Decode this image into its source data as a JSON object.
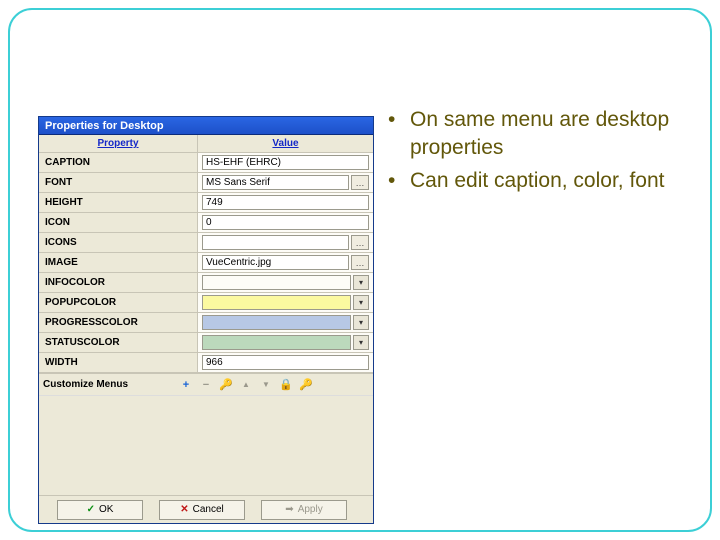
{
  "dialog": {
    "title": "Properties for Desktop",
    "header_property": "Property",
    "header_value": "Value",
    "rows": {
      "caption": {
        "label": "CAPTION",
        "value": "HS-EHF (EHRC)"
      },
      "font": {
        "label": "FONT",
        "value": "MS Sans Serif"
      },
      "height": {
        "label": "HEIGHT",
        "value": "749"
      },
      "icon": {
        "label": "ICON",
        "value": "0"
      },
      "icons": {
        "label": "ICONS",
        "value": ""
      },
      "image": {
        "label": "IMAGE",
        "value": "VueCentric.jpg"
      },
      "infocolor": {
        "label": "INFOCOLOR",
        "color": "#bcd9bc"
      },
      "popupcolor": {
        "label": "POPUPCOLOR",
        "color": "#fbf9a0"
      },
      "progresscolor": {
        "label": "PROGRESSCOLOR",
        "color": "#b7c8e5"
      },
      "statuscolor": {
        "label": "STATUSCOLOR",
        "color": "#bcd9bc"
      },
      "width": {
        "label": "WIDTH",
        "value": "966"
      }
    },
    "toolbar_label": "Customize Menus",
    "buttons": {
      "ok": "OK",
      "cancel": "Cancel",
      "apply": "Apply"
    },
    "ellipsis": "…",
    "dropdown_glyph": "▾"
  },
  "bullets": {
    "b1": "On same menu are desktop properties",
    "b2": "Can edit caption, color, font"
  },
  "icons": {
    "plus": "+",
    "minus": "−",
    "key": "🔑",
    "up": "▲",
    "down": "▼",
    "lock": "🔒",
    "check": "✓",
    "x": "✕",
    "arrow": "➡"
  }
}
